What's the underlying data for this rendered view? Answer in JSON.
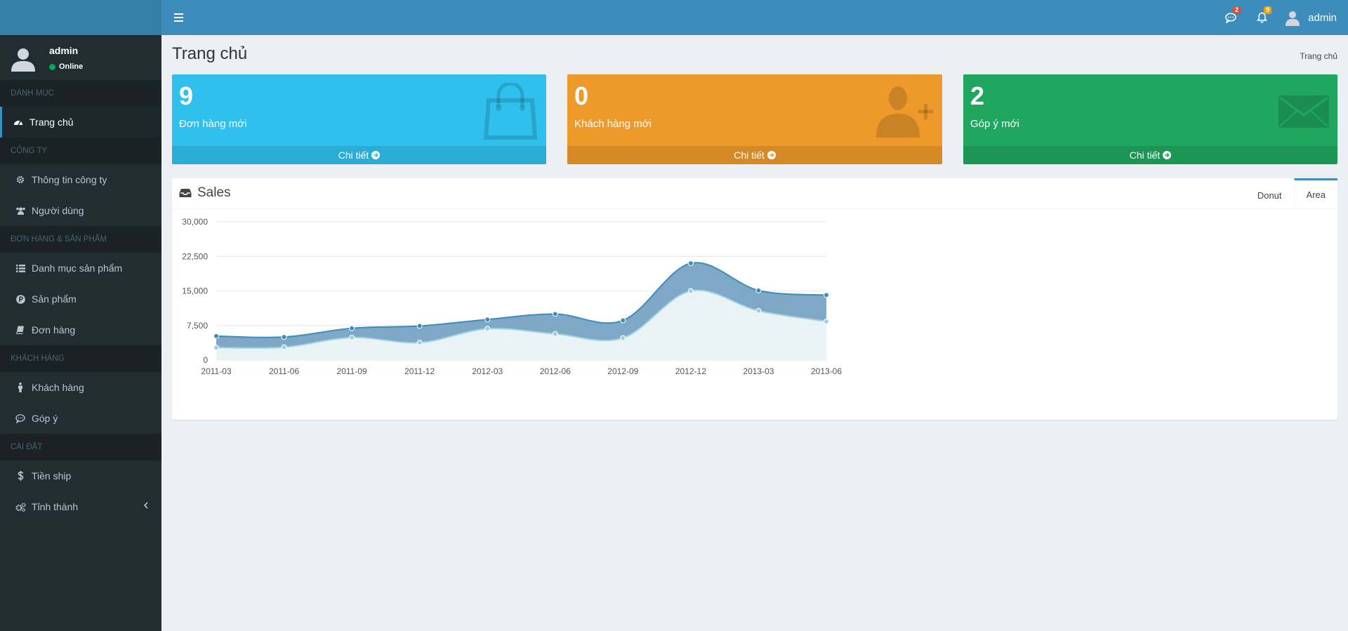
{
  "header": {
    "user_name": "admin",
    "messages_count": "2",
    "notifications_count": "9"
  },
  "sidebar": {
    "user": {
      "name": "admin",
      "status": "Online"
    },
    "sections": [
      {
        "header": "DANH MỤC",
        "items": [
          "Trang chủ"
        ]
      },
      {
        "header": "CÔNG TY",
        "items": [
          "Thông tin công ty",
          "Người dùng"
        ]
      },
      {
        "header": "ĐƠN HÀNG & SẢN PHẨM",
        "items": [
          "Danh mục sản phẩm",
          "Sản phẩm",
          "Đơn hàng"
        ]
      },
      {
        "header": "KHÁCH HÀNG",
        "items": [
          "Khách hàng",
          "Góp ý"
        ]
      },
      {
        "header": "CÀI ĐẶT",
        "items": [
          "Tiền ship",
          "Tỉnh thành"
        ]
      }
    ],
    "active_item": "Trang chủ"
  },
  "page": {
    "title": "Trang chủ",
    "breadcrumb": "Trang chủ"
  },
  "stats": [
    {
      "value": "9",
      "label": "Đơn hàng mới",
      "link": "Chi tiết",
      "color": "#2fc0ee",
      "icon": "shopping-bag-icon"
    },
    {
      "value": "0",
      "label": "Khách hàng mới",
      "link": "Chi tiết",
      "color": "#ee9a2b",
      "icon": "user-plus-icon"
    },
    {
      "value": "2",
      "label": "Góp ý mới",
      "link": "Chi tiết",
      "color": "#20a65f",
      "icon": "envelope-icon"
    }
  ],
  "sales_panel": {
    "title": "Sales",
    "tabs": [
      "Donut",
      "Area"
    ],
    "active_tab": "Area"
  },
  "chart_data": {
    "type": "area",
    "categories": [
      "2011-03",
      "2011-06",
      "2011-09",
      "2011-12",
      "2012-03",
      "2012-06",
      "2012-09",
      "2012-12",
      "2013-03",
      "2013-06"
    ],
    "series": [
      {
        "values": [
          2700,
          2800,
          4900,
          3800,
          6800,
          5700,
          4800,
          15000,
          10700,
          8400
        ],
        "color": "#a0d0e0"
      },
      {
        "values": [
          5200,
          5000,
          6900,
          7400,
          8800,
          10000,
          8600,
          21000,
          15100,
          14100
        ],
        "color": "#3c8dbc"
      }
    ],
    "ylim": [
      0,
      30000
    ],
    "yticks": [
      "0",
      "7,500",
      "15,000",
      "22,500",
      "30,000"
    ],
    "grid": true
  }
}
